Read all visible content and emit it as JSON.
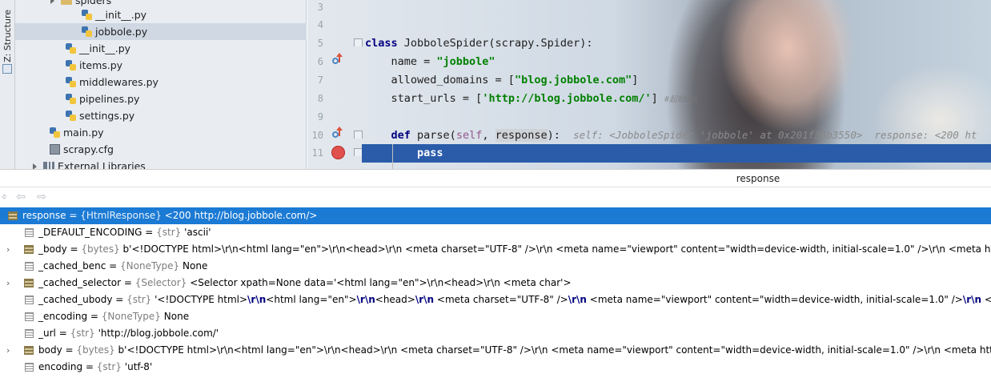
{
  "sidebar": {
    "tab_label": "Z: Structure"
  },
  "project_tree": {
    "items": [
      {
        "label": "spiders",
        "kind": "folder"
      },
      {
        "label": "__init__.py",
        "kind": "py"
      },
      {
        "label": "jobbole.py",
        "kind": "py",
        "selected": true
      },
      {
        "label": "__init__.py",
        "kind": "py"
      },
      {
        "label": "items.py",
        "kind": "py"
      },
      {
        "label": "middlewares.py",
        "kind": "py"
      },
      {
        "label": "pipelines.py",
        "kind": "py"
      },
      {
        "label": "settings.py",
        "kind": "py"
      },
      {
        "label": "main.py",
        "kind": "py"
      },
      {
        "label": "scrapy.cfg",
        "kind": "cfg"
      },
      {
        "label": "External Libraries",
        "kind": "lib"
      }
    ]
  },
  "editor": {
    "line_numbers": [
      "3",
      "4",
      "5",
      "6",
      "7",
      "8",
      "9",
      "10",
      "11"
    ],
    "code": {
      "l5_kw": "class",
      "l5_rest": " JobboleSpider(scrapy.Spider):",
      "l6_a": "    name = ",
      "l6_str": "\"jobbole\"",
      "l7_a": "    allowed_domains = [",
      "l7_str": "\"blog.jobbole.com\"",
      "l7_b": "]",
      "l8_a": "    start_urls = [",
      "l8_str": "'http://blog.jobbole.com/'",
      "l8_b": "]",
      "l8_faint": "#起始URL",
      "l10_kw": "def",
      "l10_a": " parse(",
      "l10_self": "self",
      "l10_b": ", ",
      "l10_resp": "response",
      "l10_c": "):",
      "l10_hint": "self: <JobboleSpider 'jobbole' at 0x201f36b3550>  response: <200 ht",
      "l11_kw": "pass"
    }
  },
  "debug": {
    "panel_title": "response",
    "nav_back": "⇦",
    "nav_forward": "⇨",
    "rows": [
      {
        "name": "response",
        "type": "{HtmlResponse}",
        "value": "<200 http://blog.jobbole.com/>",
        "expand": "",
        "icon": "field",
        "root": true
      },
      {
        "name": "_DEFAULT_ENCODING",
        "type": "{str}",
        "value": "'ascii'",
        "expand": "",
        "icon": "plain"
      },
      {
        "name": "_body",
        "type": "{bytes}",
        "value": "b'<!DOCTYPE html>\\r\\n<html lang=\"en\">\\r\\n<head>\\r\\n    <meta charset=\"UTF-8\" />\\r\\n    <meta name=\"viewport\" content=\"width=device-width, initial-scale=1.0\" />\\r\\n    <meta http-e",
        "expand": "›",
        "icon": "field"
      },
      {
        "name": "_cached_benc",
        "type": "{NoneType}",
        "value": "None",
        "expand": "",
        "icon": "plain"
      },
      {
        "name": "_cached_selector",
        "type": "{Selector}",
        "value": "<Selector xpath=None data='<html lang=\"en\">\\r\\n<head>\\r\\n    <meta char'>",
        "expand": "›",
        "icon": "field"
      },
      {
        "name": "_cached_ubody",
        "type": "{str}",
        "value": "'<!DOCTYPE html>",
        "value2": "<html lang=\"en\">",
        "value3": "<head>",
        "value4": "    <meta charset=\"UTF-8\" />",
        "value5": "    <meta name=\"viewport\" content=\"width=device-width, initial-scale=1.0\" />",
        "value6": "    <met",
        "esc": "\\r\\n",
        "expand": "",
        "icon": "plain"
      },
      {
        "name": "_encoding",
        "type": "{NoneType}",
        "value": "None",
        "expand": "",
        "icon": "plain"
      },
      {
        "name": "_url",
        "type": "{str}",
        "value": "'http://blog.jobbole.com/'",
        "expand": "",
        "icon": "plain"
      },
      {
        "name": "body",
        "type": "{bytes}",
        "value": "b'<!DOCTYPE html>\\r\\n<html lang=\"en\">\\r\\n<head>\\r\\n    <meta charset=\"UTF-8\" />\\r\\n    <meta name=\"viewport\" content=\"width=device-width, initial-scale=1.0\" />\\r\\n    <meta http-ec",
        "expand": "›",
        "icon": "field"
      },
      {
        "name": "encoding",
        "type": "{str}",
        "value": "'utf-8'",
        "expand": "",
        "icon": "plain"
      }
    ]
  }
}
